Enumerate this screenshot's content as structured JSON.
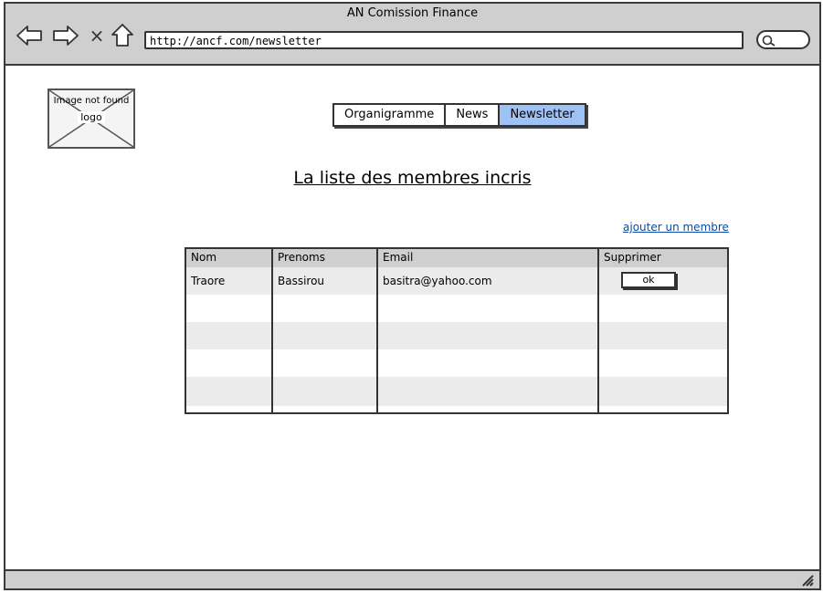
{
  "window": {
    "title": "AN Comission Finance"
  },
  "browser": {
    "url": "http://ancf.com/newsletter",
    "back_icon": "arrow-left-icon",
    "forward_icon": "arrow-right-icon",
    "close_glyph": "×",
    "home_icon": "home-icon",
    "search_icon": "search-icon"
  },
  "logo": {
    "placeholder": "Image not found",
    "label": "logo"
  },
  "tabs": [
    {
      "label": "Organigramme",
      "active": false
    },
    {
      "label": "News",
      "active": false
    },
    {
      "label": "Newsletter",
      "active": true
    }
  ],
  "page": {
    "title": "La liste  des membres incris",
    "add_link": "ajouter un membre"
  },
  "table": {
    "columns": [
      "Nom",
      "Prenoms",
      "Email",
      "Supprimer"
    ],
    "rows": [
      {
        "nom": "Traore",
        "prenoms": "Bassirou",
        "email": "basitra@yahoo.com",
        "action": "ok"
      }
    ]
  },
  "colors": {
    "active_tab": "#9ec2f5",
    "chrome": "#cfcfcf",
    "link": "#0b4aa6",
    "row_alt": "#ebebeb"
  }
}
